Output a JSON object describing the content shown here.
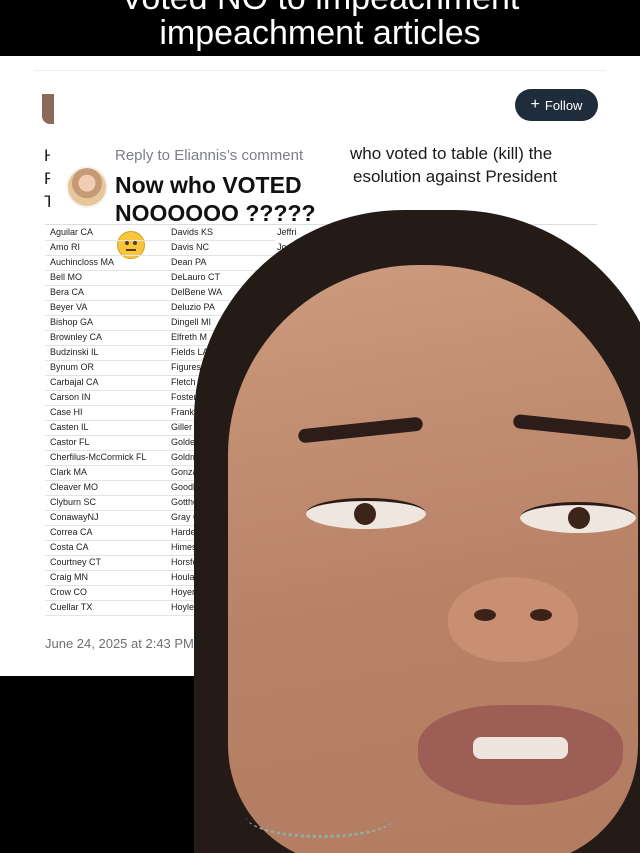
{
  "caption": {
    "line1": "Voted NO to impeachment",
    "line2": "impeachment articles"
  },
  "post": {
    "follow_label": "Follow",
    "reply_label": "Reply to Eliannis’s comment",
    "reply_text": "Now who VOTED NOOOOOO ?????",
    "text_line1": "who voted to table (kill) the",
    "text_line2": "esolution against President",
    "left_fragments": [
      "H",
      "F",
      "T"
    ],
    "date": "June 24, 2025 at 2:43 PM"
  },
  "sheet": {
    "rows": [
      [
        "Aguilar CA",
        "Davids KS",
        "Jeffri"
      ],
      [
        "Amo RI",
        "Davis NC",
        "Jo"
      ],
      [
        "Auchincloss MA",
        "Dean PA",
        ""
      ],
      [
        "Bell MO",
        "DeLauro CT",
        ""
      ],
      [
        "Bera CA",
        "DelBene WA",
        ""
      ],
      [
        "Beyer VA",
        "Deluzio PA",
        ""
      ],
      [
        "Bishop GA",
        "Dingell MI",
        ""
      ],
      [
        "Brownley CA",
        "Elfreth M",
        ""
      ],
      [
        "Budzinski IL",
        "Fields LA",
        ""
      ],
      [
        "Bynum OR",
        "Figures",
        ""
      ],
      [
        "Carbajal CA",
        "Fletch",
        ""
      ],
      [
        "Carson IN",
        "Foster I",
        ""
      ],
      [
        "Case HI",
        "Franke",
        ""
      ],
      [
        "Casten IL",
        "Giller",
        ""
      ],
      [
        "Castor FL",
        "Golde",
        ""
      ],
      [
        "Cherfilus-McCormick FL",
        "Goldm",
        ""
      ],
      [
        "Clark MA",
        "Gonzal",
        ""
      ],
      [
        "Cleaver MO",
        "Goodla",
        ""
      ],
      [
        "Clyburn SC",
        "Gotthei",
        ""
      ],
      [
        "ConawayNJ",
        "Gray CA",
        ""
      ],
      [
        "Correa CA",
        "Harder",
        ""
      ],
      [
        "Costa CA",
        "Himes C",
        ""
      ],
      [
        "Courtney CT",
        "Horsford",
        ""
      ],
      [
        "Craig MN",
        "Houlahan",
        ""
      ],
      [
        "Crow CO",
        "Hoyer MD",
        ""
      ],
      [
        "Cuellar TX",
        "Hoyle OR",
        ""
      ]
    ]
  },
  "icons": [
    "plus-icon",
    "group-icon",
    "thinking-face-emoji"
  ]
}
